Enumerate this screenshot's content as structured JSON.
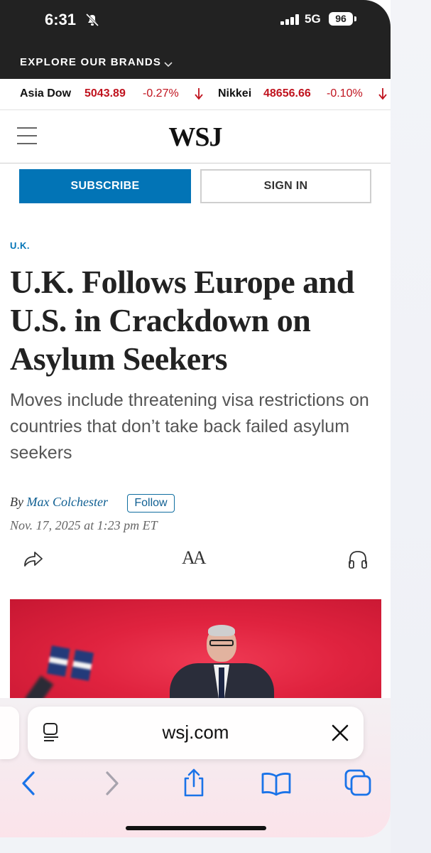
{
  "status_bar": {
    "time": "6:31",
    "network": "5G",
    "battery": "96"
  },
  "brands_bar": {
    "label": "EXPLORE OUR BRANDS"
  },
  "ticker": [
    {
      "name": "Asia Dow",
      "value": "5043.89",
      "change": "-0.27%"
    },
    {
      "name": "Nikkei",
      "value": "48656.66",
      "change": "-0.10%"
    }
  ],
  "header": {
    "logo": "WSJ",
    "subscribe_label": "SUBSCRIBE",
    "signin_label": "SIGN IN"
  },
  "article": {
    "section": "U.K.",
    "headline": "U.K. Follows Europe and U.S. in Crackdown on Asylum Seekers",
    "dek": "Moves include threatening visa restrictions on countries that don’t take back failed asylum seekers",
    "by_prefix": "By",
    "author": "Max Colchester",
    "follow_label": "Follow",
    "date": "Nov. 17, 2025 at 1:23 pm ET",
    "text_size_label": "AA"
  },
  "browser": {
    "url": "wsj.com"
  },
  "colors": {
    "wsj_blue": "#0274b6",
    "ticker_red": "#c0131e",
    "ios_blue": "#1a73e8"
  },
  "icons": [
    "bell-slash-icon",
    "signal-icon",
    "chevron-down-icon",
    "down-arrow-icon",
    "hamburger-menu-icon",
    "share-icon",
    "text-size-icon",
    "headphones-icon",
    "reader-icon",
    "close-icon",
    "back-icon",
    "forward-icon",
    "share-icon",
    "bookmarks-icon",
    "tabs-icon"
  ]
}
